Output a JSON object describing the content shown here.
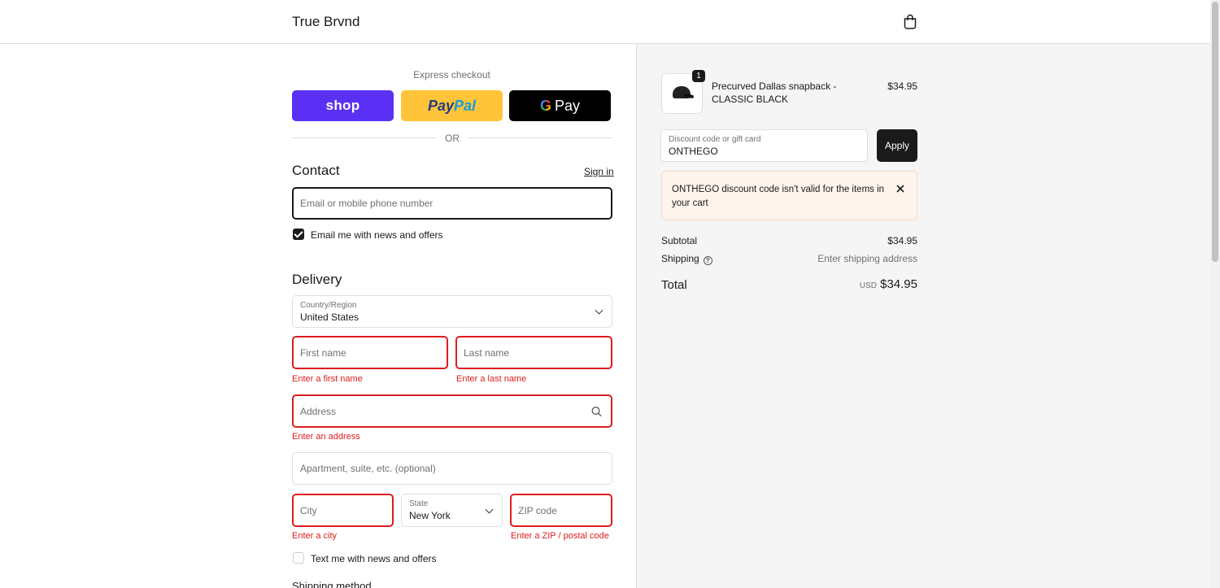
{
  "header": {
    "brand": "True Brvnd",
    "cart_icon": "shopping-bag-icon"
  },
  "express": {
    "label": "Express checkout",
    "shop_label": "shop",
    "paypal_part1": "Pay",
    "paypal_part2": "Pal",
    "gpay_g": "G",
    "gpay_label": "Pay",
    "or_label": "OR"
  },
  "contact": {
    "title": "Contact",
    "sign_in": "Sign in",
    "email_placeholder": "Email or mobile phone number",
    "news_checkbox_label": "Email me with news and offers",
    "news_checked": true
  },
  "delivery": {
    "title": "Delivery",
    "country_label": "Country/Region",
    "country_value": "United States",
    "first_name_placeholder": "First name",
    "first_name_error": "Enter a first name",
    "last_name_placeholder": "Last name",
    "last_name_error": "Enter a last name",
    "address_placeholder": "Address",
    "address_error": "Enter an address",
    "apartment_placeholder": "Apartment, suite, etc. (optional)",
    "city_placeholder": "City",
    "city_error": "Enter a city",
    "state_label": "State",
    "state_value": "New York",
    "zip_placeholder": "ZIP code",
    "zip_error": "Enter a ZIP / postal code",
    "text_checkbox_label": "Text me with news and offers",
    "text_checked": false
  },
  "shipping_method": {
    "title": "Shipping method"
  },
  "summary": {
    "product": {
      "name": "Precurved Dallas snapback - CLASSIC BLACK",
      "price": "$34.95",
      "quantity": "1"
    },
    "discount": {
      "label": "Discount code or gift card",
      "value": "ONTHEGO",
      "apply_label": "Apply"
    },
    "notice": "ONTHEGO discount code isn't valid for the items in your cart",
    "subtotal_label": "Subtotal",
    "subtotal_value": "$34.95",
    "shipping_label": "Shipping",
    "shipping_value": "Enter shipping address",
    "total_label": "Total",
    "total_currency": "USD",
    "total_value": "$34.95"
  },
  "colors": {
    "shop": "#5a31f4",
    "paypal": "#ffc439",
    "error": "#dd1d1d",
    "notice_bg": "#fff4ec"
  }
}
